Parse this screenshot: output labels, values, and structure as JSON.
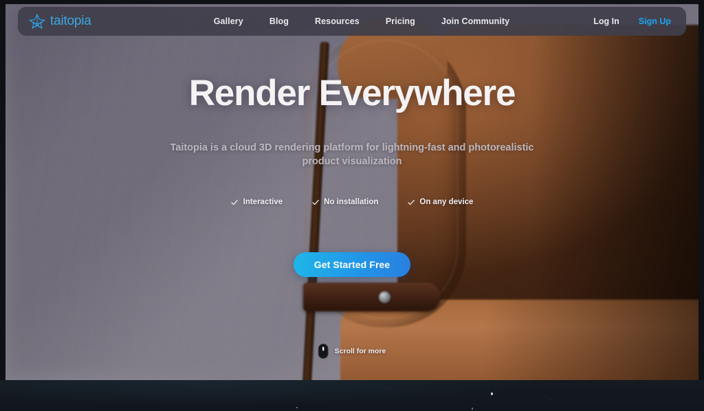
{
  "navbar": {
    "brand": {
      "icon": "star-constellation-logo",
      "name": "taitopia",
      "color": "#3ea8e5"
    },
    "links": [
      {
        "label": "Gallery"
      },
      {
        "label": "Blog"
      },
      {
        "label": "Resources"
      },
      {
        "label": "Pricing"
      },
      {
        "label": "Join Community"
      }
    ],
    "login_label": "Log In",
    "signup_label": "Sign Up",
    "signup_color": "#1fa2ee"
  },
  "hero": {
    "title": "Render Everywhere",
    "subtitle": "Taitopia is a cloud 3D rendering platform for lightning-fast and photorealistic product visualization",
    "features": [
      {
        "icon": "check-icon",
        "label": "Interactive"
      },
      {
        "icon": "check-icon",
        "label": "No installation"
      },
      {
        "icon": "check-icon",
        "label": "On any device"
      }
    ],
    "cta_label": "Get Started Free",
    "cta_gradient_from": "#1fb6e8",
    "cta_gradient_to": "#2a7fe0",
    "scroll_hint": {
      "icon": "mouse-scroll-icon",
      "label": "Scroll for more"
    },
    "background": "photo of a tan leather lounge chair against a grey-purple wall"
  }
}
